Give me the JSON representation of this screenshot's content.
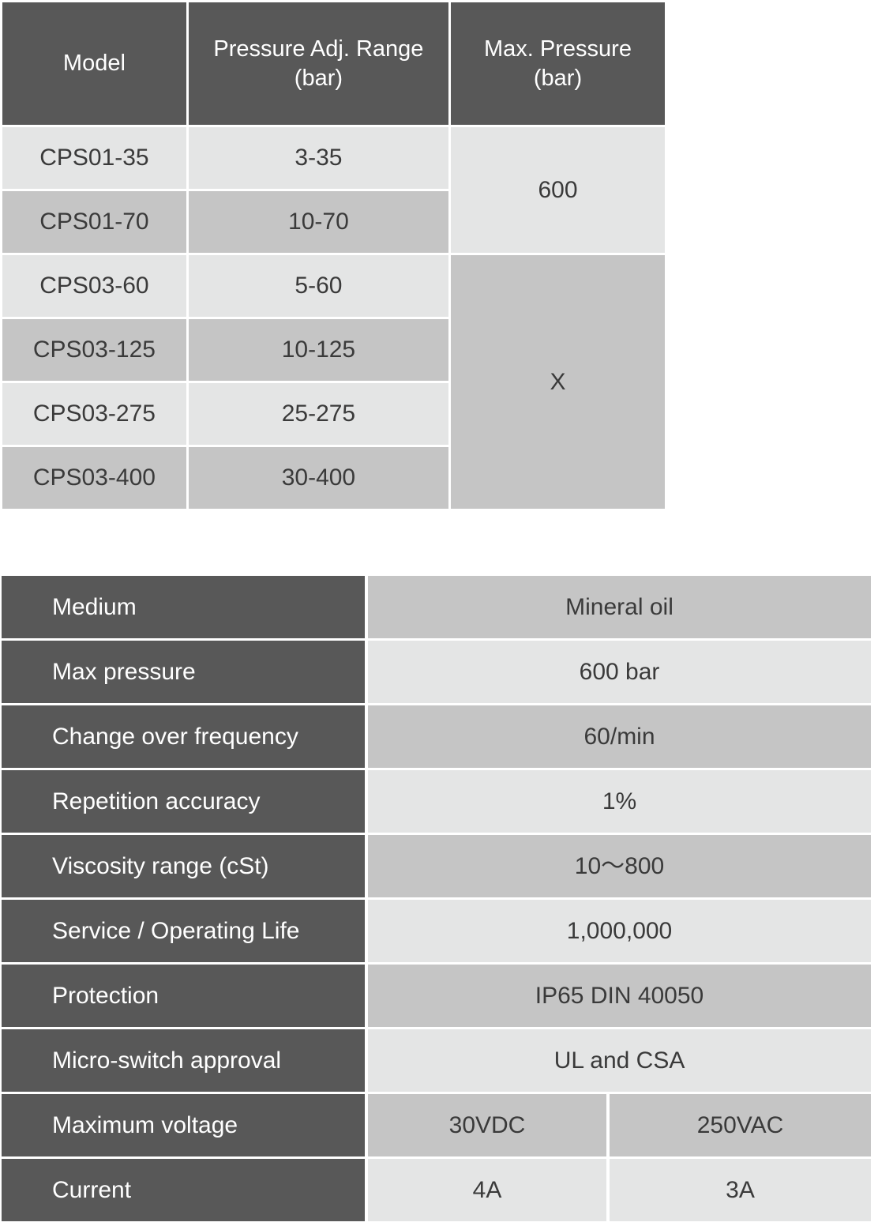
{
  "colors": {
    "header_dark": "#585858",
    "row_light": "#e4e5e5",
    "row_medium": "#c5c5c5",
    "text_dark": "#3a3a3a",
    "text_light": "#ffffff",
    "page_background": "#ffffff"
  },
  "model_table": {
    "headers": {
      "model": "Model",
      "pressure_range": "Pressure Adj. Range\n(bar)",
      "pressure_range_line1": "Pressure Adj. Range",
      "pressure_range_line2": "(bar)",
      "max_pressure_line1": "Max. Pressure",
      "max_pressure_line2": "(bar)"
    },
    "rows": [
      {
        "model": "CPS01-35",
        "range": "3-35",
        "shade": "light"
      },
      {
        "model": "CPS01-70",
        "range": "10-70",
        "shade": "medium"
      },
      {
        "model": "CPS03-60",
        "range": "5-60",
        "shade": "light"
      },
      {
        "model": "CPS03-125",
        "range": "10-125",
        "shade": "medium"
      },
      {
        "model": "CPS03-275",
        "range": "25-275",
        "shade": "light"
      },
      {
        "model": "CPS03-400",
        "range": "30-400",
        "shade": "medium"
      }
    ],
    "max_pressure_groups": [
      {
        "value": "600",
        "rowspan": 2,
        "shade": "light"
      },
      {
        "value": "X",
        "rowspan": 4,
        "shade": "medium"
      }
    ]
  },
  "spec_table": {
    "rows": [
      {
        "label": "Medium",
        "value": "Mineral oil",
        "shade": "medium",
        "split": false
      },
      {
        "label": "Max pressure",
        "value": "600 bar",
        "shade": "light",
        "split": false
      },
      {
        "label": "Change over frequency",
        "value": "60/min",
        "shade": "medium",
        "split": false
      },
      {
        "label": "Repetition accuracy",
        "value": "1%",
        "shade": "light",
        "split": false
      },
      {
        "label": "Viscosity range (cSt)",
        "value": "10〜800",
        "shade": "medium",
        "split": false
      },
      {
        "label": "Service / Operating Life",
        "value": "1,000,000",
        "shade": "light",
        "split": false
      },
      {
        "label": "Protection",
        "value": "IP65 DIN 40050",
        "shade": "medium",
        "split": false
      },
      {
        "label": "Micro-switch approval",
        "value": "UL and CSA",
        "shade": "light",
        "split": false
      },
      {
        "label": "Maximum voltage",
        "value_a": "30VDC",
        "value_b": "250VAC",
        "shade": "medium",
        "split": true
      },
      {
        "label": "Current",
        "value_a": "4A",
        "value_b": "3A",
        "shade": "light",
        "split": true
      }
    ]
  }
}
